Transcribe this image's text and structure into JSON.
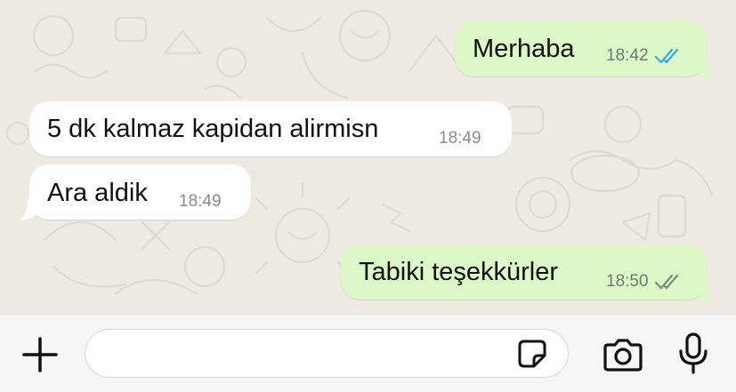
{
  "messages": [
    {
      "direction": "outgoing",
      "text": "Merhaba",
      "time": "18:42",
      "status": "read"
    },
    {
      "direction": "incoming",
      "text": "5 dk kalmaz kapidan alirmisn",
      "time": "18:49"
    },
    {
      "direction": "incoming",
      "text": "Ara aldik",
      "time": "18:49"
    },
    {
      "direction": "outgoing",
      "text": "Tabiki teşekkürler",
      "time": "18:50",
      "status": "delivered"
    }
  ],
  "input_bar": {
    "message_value": "",
    "message_placeholder": "",
    "icons": [
      "plus-icon",
      "sticker-icon",
      "camera-icon",
      "microphone-icon"
    ]
  },
  "colors": {
    "chat_background": "#efeae2",
    "outgoing_bubble": "#dcf8c6",
    "incoming_bubble": "#ffffff",
    "read_ticks": "#34a7f0",
    "delivered_ticks": "#7c8a82",
    "input_bar_background": "#f6f6f6"
  }
}
